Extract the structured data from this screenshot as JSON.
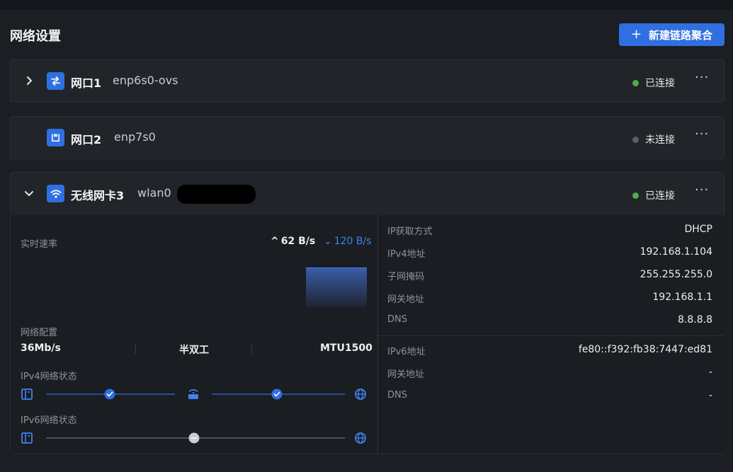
{
  "page": {
    "title": "网络设置",
    "new_button": {
      "icon": "+",
      "label": "新建链路聚合"
    }
  },
  "interfaces": [
    {
      "name": "网口1",
      "device": "enp6s0-ovs",
      "status": "已连接",
      "status_color": "#4caf50",
      "icon": "swap-arrows-icon",
      "expanded": false
    },
    {
      "name": "网口2",
      "device": "enp7s0",
      "status": "未连接",
      "status_color": "#5b6169",
      "icon": "ethernet-port-icon",
      "expanded": false
    },
    {
      "name": "无线网卡3",
      "device": "wlan0",
      "status": "已连接",
      "status_color": "#4caf50",
      "icon": "wifi-icon",
      "expanded": true
    }
  ],
  "more_label": "···",
  "wlan_details": {
    "speed": {
      "label": "实时速率",
      "upload": "62 B/s",
      "download": "120 B/s",
      "up_icon": "^",
      "down_icon": "⌄"
    },
    "config": {
      "label": "网络配置",
      "speed": "36Mb/s",
      "duplex": "半双工",
      "mtu": "MTU1500"
    },
    "ipv4_status": {
      "label": "IPv4网络状态"
    },
    "ipv6_status": {
      "label": "IPv6网络状态"
    },
    "ipv4": [
      {
        "label": "IP获取方式",
        "value": "DHCP"
      },
      {
        "label": "IPv4地址",
        "value": "192.168.1.104"
      },
      {
        "label": "子网掩码",
        "value": "255.255.255.0"
      },
      {
        "label": "网关地址",
        "value": "192.168.1.1"
      },
      {
        "label": "DNS",
        "value": "8.8.8.8"
      }
    ],
    "ipv6": [
      {
        "label": "IPv6地址",
        "value": "fe80::f392:fb38:7447:ed81"
      },
      {
        "label": "网关地址",
        "value": "-"
      },
      {
        "label": "DNS",
        "value": "-"
      }
    ]
  },
  "colors": {
    "accent": "#2f6fe0",
    "connected": "#4caf50",
    "disconnected": "#5b6169"
  }
}
